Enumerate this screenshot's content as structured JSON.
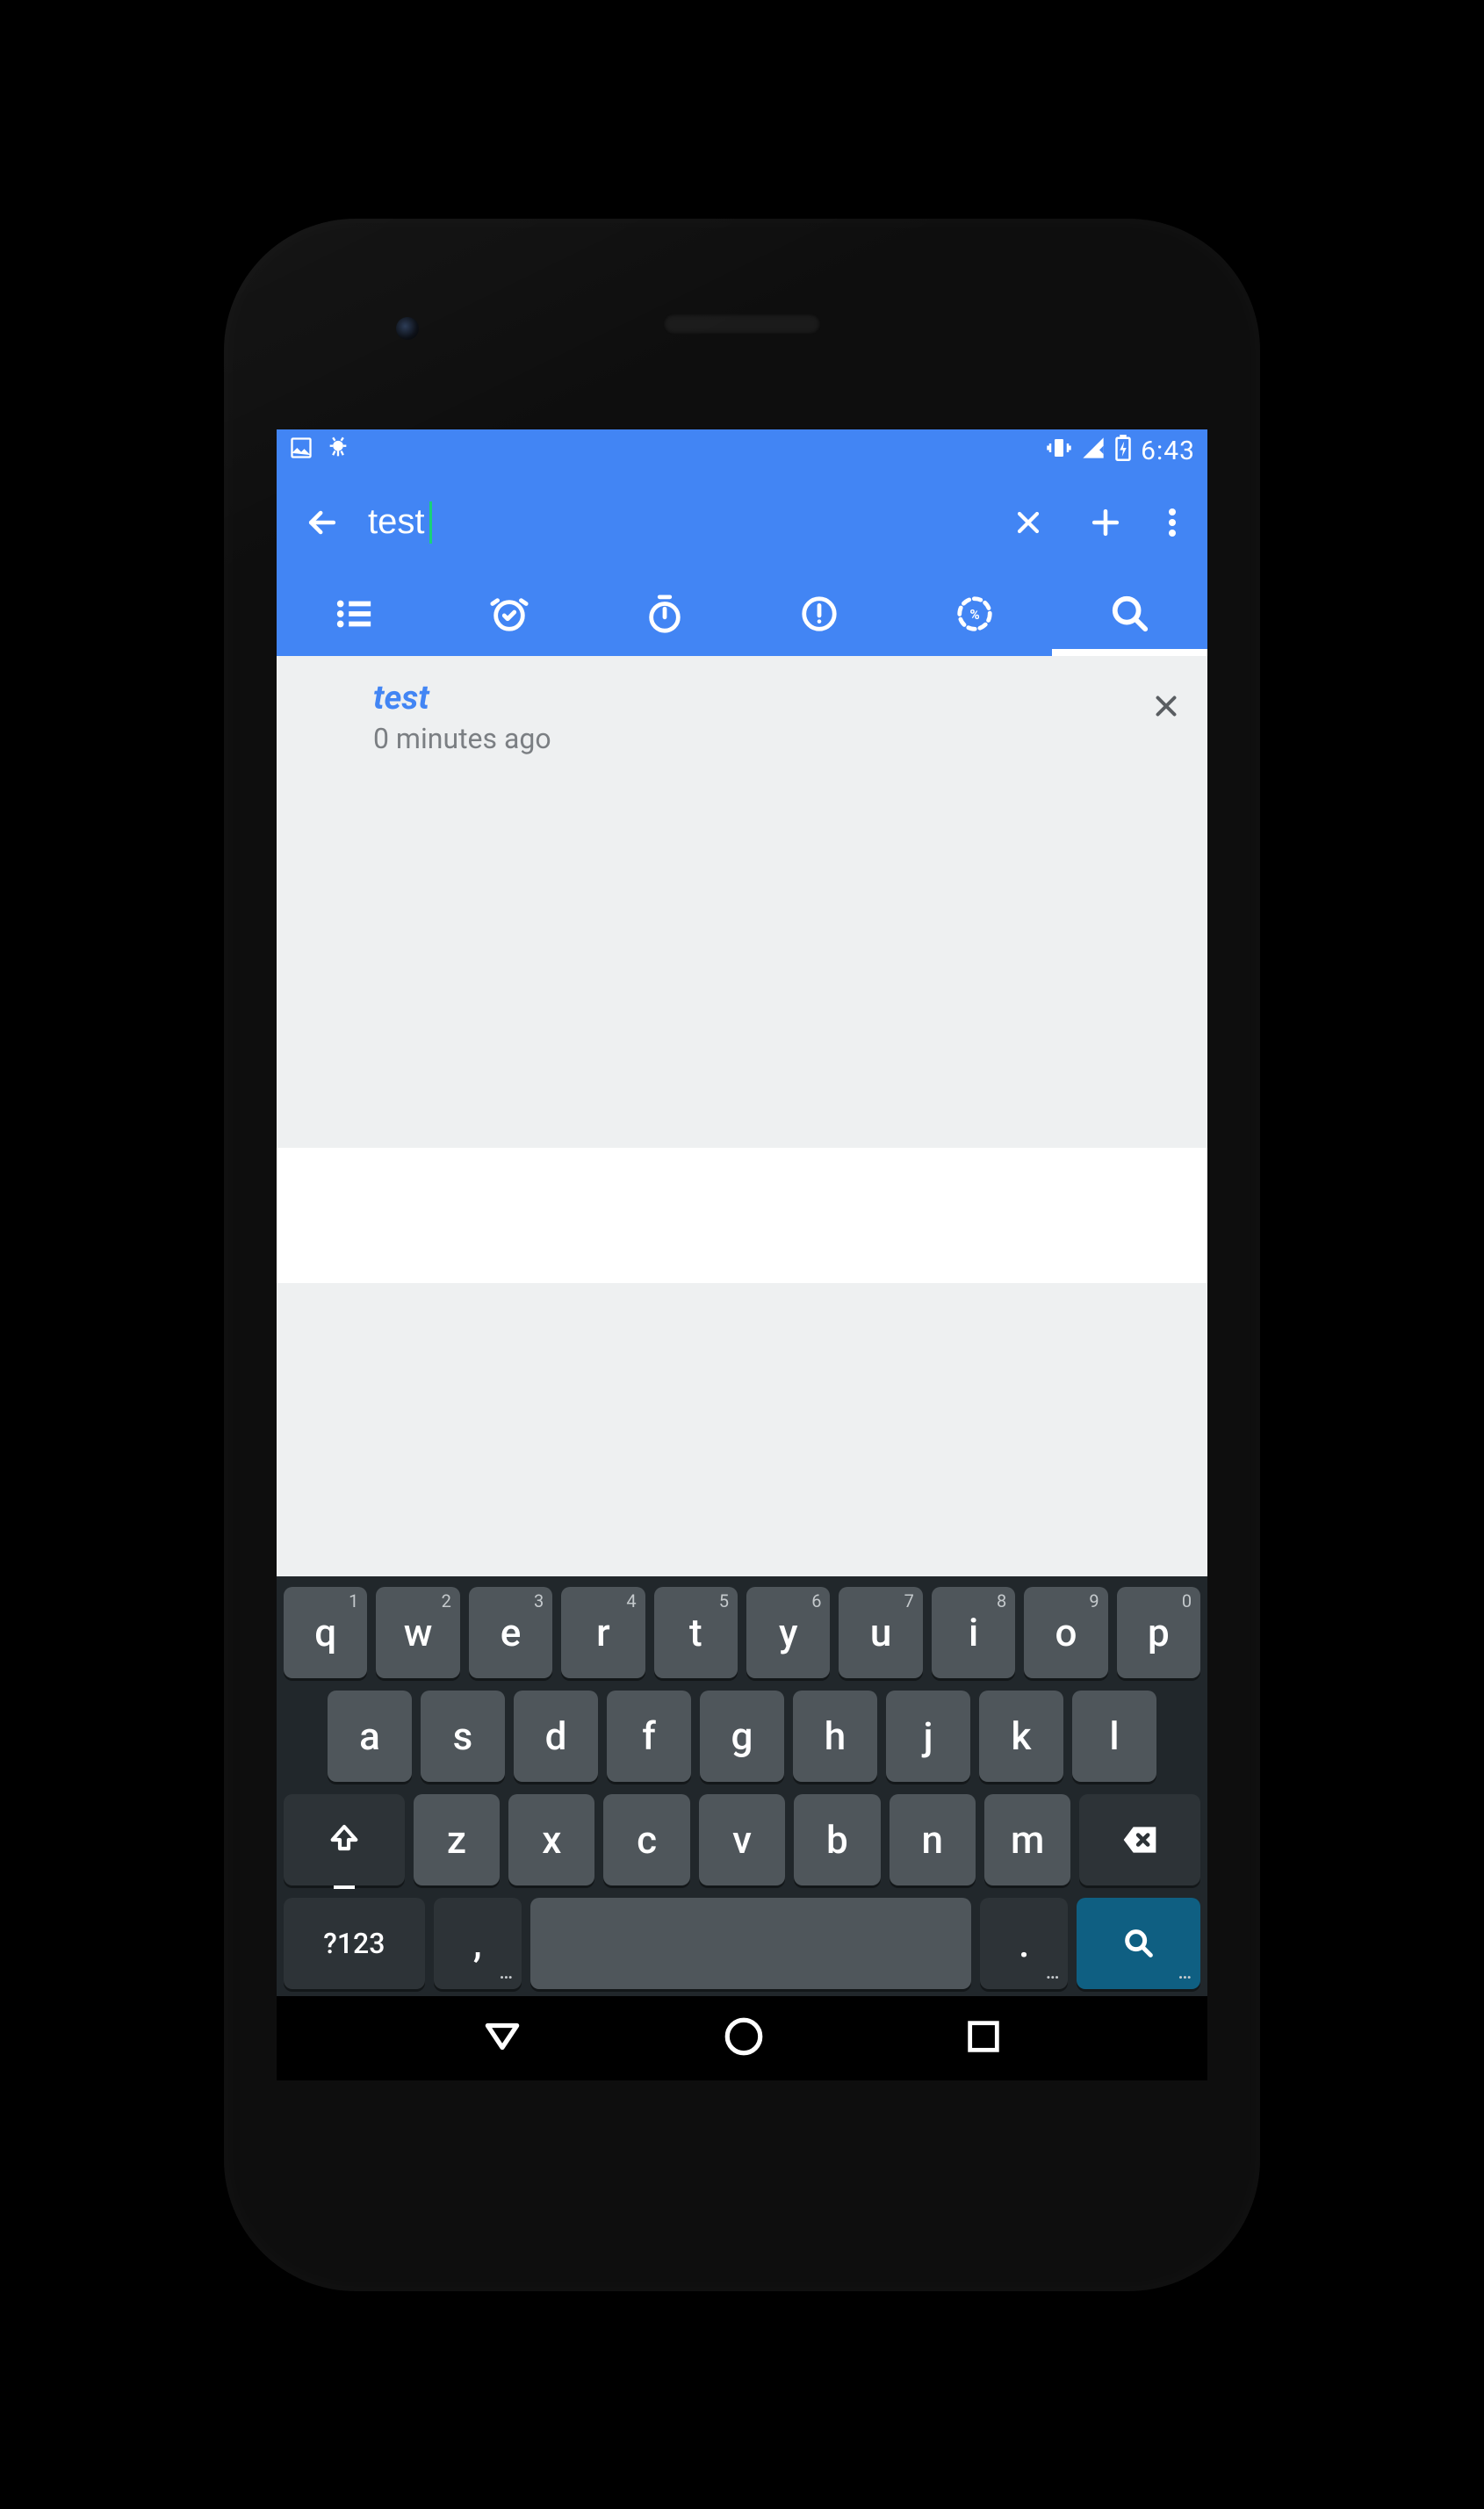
{
  "status": {
    "time": "6:43"
  },
  "appbar": {
    "search_value": "test"
  },
  "tabs": {
    "active_index": 5
  },
  "results": [
    {
      "title": "test",
      "subtitle": "0 minutes ago"
    }
  ],
  "keyboard": {
    "row1": [
      "q",
      "w",
      "e",
      "r",
      "t",
      "y",
      "u",
      "i",
      "o",
      "p"
    ],
    "row1_hints": [
      "1",
      "2",
      "3",
      "4",
      "5",
      "6",
      "7",
      "8",
      "9",
      "0"
    ],
    "row2": [
      "a",
      "s",
      "d",
      "f",
      "g",
      "h",
      "j",
      "k",
      "l"
    ],
    "row3": [
      "z",
      "x",
      "c",
      "v",
      "b",
      "n",
      "m"
    ],
    "symbols_label": "?123",
    "comma_label": ",",
    "period_label": "."
  }
}
